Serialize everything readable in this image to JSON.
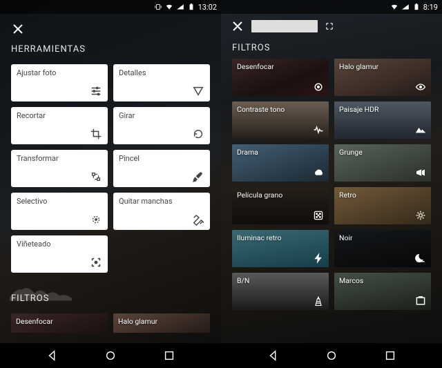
{
  "left": {
    "status_time": "13:02",
    "section_tools": "HERRAMIENTAS",
    "section_filters": "FILTROS",
    "tools": [
      {
        "label": "Ajustar foto",
        "icon": "tune-icon"
      },
      {
        "label": "Detalles",
        "icon": "triangle-down-icon"
      },
      {
        "label": "Recortar",
        "icon": "crop-icon"
      },
      {
        "label": "Girar",
        "icon": "rotate-icon"
      },
      {
        "label": "Transformar",
        "icon": "transform-icon"
      },
      {
        "label": "Pincel",
        "icon": "brush-icon"
      },
      {
        "label": "Selectivo",
        "icon": "target-icon"
      },
      {
        "label": "Quitar manchas",
        "icon": "healing-icon"
      },
      {
        "label": "Viñeteado",
        "icon": "vignette-icon"
      }
    ],
    "filters_peek": [
      {
        "label": "Desenfocar"
      },
      {
        "label": "Halo glamur"
      }
    ]
  },
  "right": {
    "status_time": "8:19",
    "section_filters": "FILTROS",
    "filters": [
      {
        "label": "Desenfocar",
        "icon": "blur-icon",
        "bg": "linear-gradient(160deg,#5a3a3a,#2a1a1a 60%,#402020)"
      },
      {
        "label": "Halo glamur",
        "icon": "eye-icon",
        "bg": "linear-gradient(160deg,#8a6a5a,#3a2a24)"
      },
      {
        "label": "Contraste tono",
        "icon": "pulse-icon",
        "bg": "linear-gradient(180deg,#a49080,#3a3028)"
      },
      {
        "label": "Paisaje HDR",
        "icon": "mountains-icon",
        "bg": "linear-gradient(180deg,#7a8898,#3a4250 90%)"
      },
      {
        "label": "Drama",
        "icon": "cloud-icon",
        "bg": "linear-gradient(160deg,#6a90b0,#2a4050)"
      },
      {
        "label": "Grunge",
        "icon": "megaphone-icon",
        "bg": "linear-gradient(160deg,#8a9a8a,#404a40)"
      },
      {
        "label": "Película grano",
        "icon": "dice-icon",
        "bg": "linear-gradient(180deg,#3a3028,#1a1410)"
      },
      {
        "label": "Retro",
        "icon": "gear-icon",
        "bg": "linear-gradient(160deg,#b08a5a,#504028)"
      },
      {
        "label": "Iluminac retro",
        "icon": "bolt-icon",
        "bg": "linear-gradient(170deg,#5aa0b0,#206070)"
      },
      {
        "label": "Noir",
        "icon": "moon-icon",
        "bg": "linear-gradient(170deg,#202428,#0a0c0e)"
      },
      {
        "label": "B/N",
        "icon": "tower-icon",
        "bg": "linear-gradient(180deg,#8a8a8a,#2a2a2a)"
      },
      {
        "label": "Marcos",
        "icon": "frame-icon",
        "bg": "linear-gradient(170deg,#6a7a6a,#2a3228)"
      }
    ]
  }
}
